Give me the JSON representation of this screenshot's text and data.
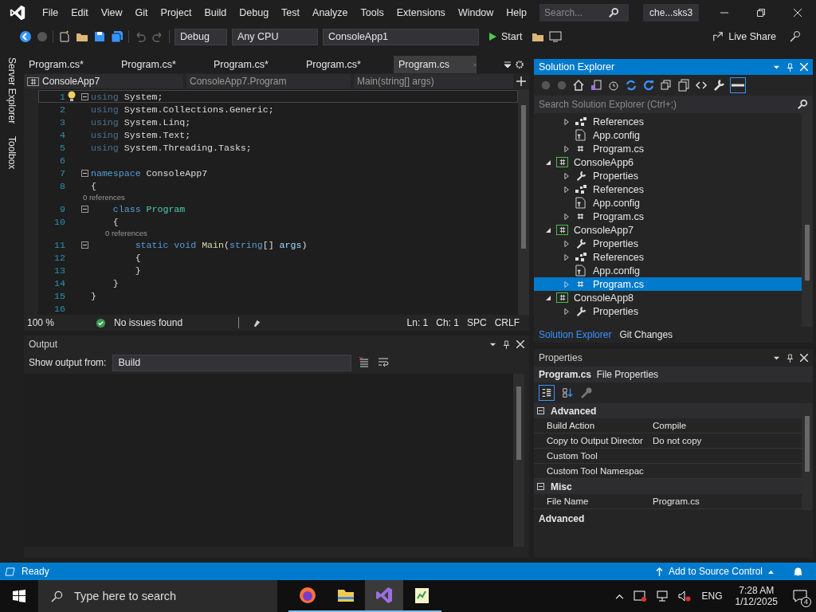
{
  "menu": {
    "items": [
      "File",
      "Edit",
      "View",
      "Git",
      "Project",
      "Build",
      "Debug",
      "Test",
      "Analyze",
      "Tools",
      "Extensions",
      "Window",
      "Help"
    ]
  },
  "search": {
    "placeholder": "Search..."
  },
  "solution_name": "che...sks3",
  "toolbar": {
    "configuration": "Debug",
    "platform": "Any CPU",
    "startup_project": "ConsoleApp1",
    "start": "Start",
    "live_share": "Live Share"
  },
  "side_tabs": [
    "Server Explorer",
    "Toolbox"
  ],
  "editor_tabs": [
    {
      "label": "Program.cs*",
      "selected": false
    },
    {
      "label": "Program.cs*",
      "selected": false
    },
    {
      "label": "Program.cs*",
      "selected": false
    },
    {
      "label": "Program.cs*",
      "selected": false
    },
    {
      "label": "Program.cs",
      "selected": true
    }
  ],
  "nav_bar": {
    "project": "ConsoleApp7",
    "class": "ConsoleApp7.Program",
    "member": "Main(string[] args)"
  },
  "code_lines": [
    {
      "number": "1",
      "collapsible": true,
      "tokens": [
        {
          "kind": "faded",
          "text": "using"
        },
        {
          "kind": "plain",
          "text": " System;"
        }
      ]
    },
    {
      "number": "2",
      "collapsible": false,
      "tokens": [
        {
          "kind": "faded",
          "text": "using"
        },
        {
          "kind": "plain",
          "text": " System.Collections.Generic;"
        }
      ]
    },
    {
      "number": "3",
      "collapsible": false,
      "tokens": [
        {
          "kind": "faded",
          "text": "using"
        },
        {
          "kind": "plain",
          "text": " System.Linq;"
        }
      ]
    },
    {
      "number": "4",
      "collapsible": false,
      "tokens": [
        {
          "kind": "faded",
          "text": "using"
        },
        {
          "kind": "plain",
          "text": " System.Text;"
        }
      ]
    },
    {
      "number": "5",
      "collapsible": false,
      "tokens": [
        {
          "kind": "faded",
          "text": "using"
        },
        {
          "kind": "plain",
          "text": " System.Threading.Tasks;"
        }
      ]
    },
    {
      "number": "6",
      "collapsible": false
    },
    {
      "number": "7",
      "collapsible": true,
      "tokens": [
        {
          "kind": "keyword",
          "text": "namespace"
        },
        {
          "kind": "plain",
          "text": " ConsoleApp7"
        }
      ]
    },
    {
      "number": "8",
      "collapsible": false,
      "tokens": [
        {
          "kind": "plain",
          "text": "{"
        }
      ]
    },
    {
      "number": "9",
      "collapsible": true,
      "codelens": "0 references",
      "tokens": [
        {
          "kind": "keyword",
          "text": "    class"
        },
        {
          "kind": "type",
          "text": " Program"
        }
      ]
    },
    {
      "number": "10",
      "collapsible": false,
      "tokens": [
        {
          "kind": "plain",
          "text": "    {"
        }
      ]
    },
    {
      "number": "11",
      "collapsible": true,
      "codelens": "0 references",
      "tokens": [
        {
          "kind": "keyword",
          "text": "        static"
        },
        {
          "kind": "keyword",
          "text": " void"
        },
        {
          "kind": "method",
          "text": " Main"
        },
        {
          "kind": "plain",
          "text": "("
        },
        {
          "kind": "keyword",
          "text": "string"
        },
        {
          "kind": "plain",
          "text": "[] "
        },
        {
          "kind": "param",
          "text": "args"
        },
        {
          "kind": "plain",
          "text": ")"
        }
      ]
    },
    {
      "number": "12",
      "collapsible": false,
      "tokens": [
        {
          "kind": "plain",
          "text": "        {"
        }
      ]
    },
    {
      "number": "13",
      "collapsible": false,
      "tokens": [
        {
          "kind": "plain",
          "text": "        }"
        }
      ]
    },
    {
      "number": "14",
      "collapsible": false,
      "tokens": [
        {
          "kind": "plain",
          "text": "    }"
        }
      ]
    },
    {
      "number": "15",
      "collapsible": false,
      "tokens": [
        {
          "kind": "plain",
          "text": "}"
        }
      ]
    },
    {
      "number": "16",
      "collapsible": false
    }
  ],
  "editor_status": {
    "zoom": "100 %",
    "issues": "No issues found",
    "line": "Ln: 1",
    "column": "Ch: 1",
    "whitespace": "SPC",
    "line_endings": "CRLF"
  },
  "output": {
    "title": "Output",
    "source_label": "Show output from:",
    "source": "Build"
  },
  "solution_explorer": {
    "title": "Solution Explorer",
    "search_placeholder": "Search Solution Explorer (Ctrl+;)",
    "tree": [
      {
        "kind": "partial",
        "children": [
          {
            "kind": "references",
            "label": "References",
            "expanded": false,
            "selected": false
          },
          {
            "kind": "config",
            "label": "App.config",
            "selected": false
          },
          {
            "kind": "csfile",
            "label": "Program.cs",
            "expanded": false,
            "selected": false
          }
        ]
      },
      {
        "kind": "project",
        "label": "ConsoleApp6",
        "expanded": true,
        "selected": false,
        "children": [
          {
            "kind": "properties",
            "label": "Properties",
            "expanded": false,
            "selected": false
          },
          {
            "kind": "references",
            "label": "References",
            "expanded": false,
            "selected": false
          },
          {
            "kind": "config",
            "label": "App.config",
            "selected": false
          },
          {
            "kind": "csfile",
            "label": "Program.cs",
            "expanded": false,
            "selected": false
          }
        ]
      },
      {
        "kind": "project",
        "label": "ConsoleApp7",
        "expanded": true,
        "selected": false,
        "children": [
          {
            "kind": "properties",
            "label": "Properties",
            "expanded": false,
            "selected": false
          },
          {
            "kind": "references",
            "label": "References",
            "expanded": false,
            "selected": false
          },
          {
            "kind": "config",
            "label": "App.config",
            "selected": false
          },
          {
            "kind": "csfile",
            "label": "Program.cs",
            "expanded": false,
            "selected": true
          }
        ]
      },
      {
        "kind": "project",
        "label": "ConsoleApp8",
        "expanded": true,
        "selected": false,
        "children": [
          {
            "kind": "properties",
            "label": "Properties",
            "expanded": false,
            "selected": false
          }
        ]
      }
    ],
    "tabs": [
      {
        "label": "Solution Explorer",
        "selected": true
      },
      {
        "label": "Git Changes",
        "selected": false
      }
    ]
  },
  "properties": {
    "title": "Properties",
    "object": "Program.cs",
    "object_type": "File Properties",
    "categories": [
      {
        "name": "Advanced",
        "expanded": true,
        "rows": [
          {
            "name": "Build Action",
            "value": "Compile"
          },
          {
            "name": "Copy to Output Director",
            "value": "Do not copy"
          },
          {
            "name": "Custom Tool"
          },
          {
            "name": "Custom Tool Namespac"
          }
        ]
      },
      {
        "name": "Misc",
        "expanded": true,
        "rows": [
          {
            "name": "File Name",
            "value": "Program.cs"
          }
        ]
      }
    ],
    "description": "Advanced"
  },
  "status_bar": {
    "state": "Ready",
    "source_control": "Add to Source Control"
  },
  "taskbar": {
    "search_placeholder": "Type here to search",
    "apps": [
      {
        "kind": "browser",
        "selected": false
      },
      {
        "kind": "folder",
        "selected": false
      },
      {
        "kind": "ide",
        "selected": true
      },
      {
        "kind": "notepad",
        "selected": false
      }
    ],
    "language": "ENG",
    "time": "7:28 AM",
    "date": "1/12/2025",
    "notifications": "4"
  }
}
